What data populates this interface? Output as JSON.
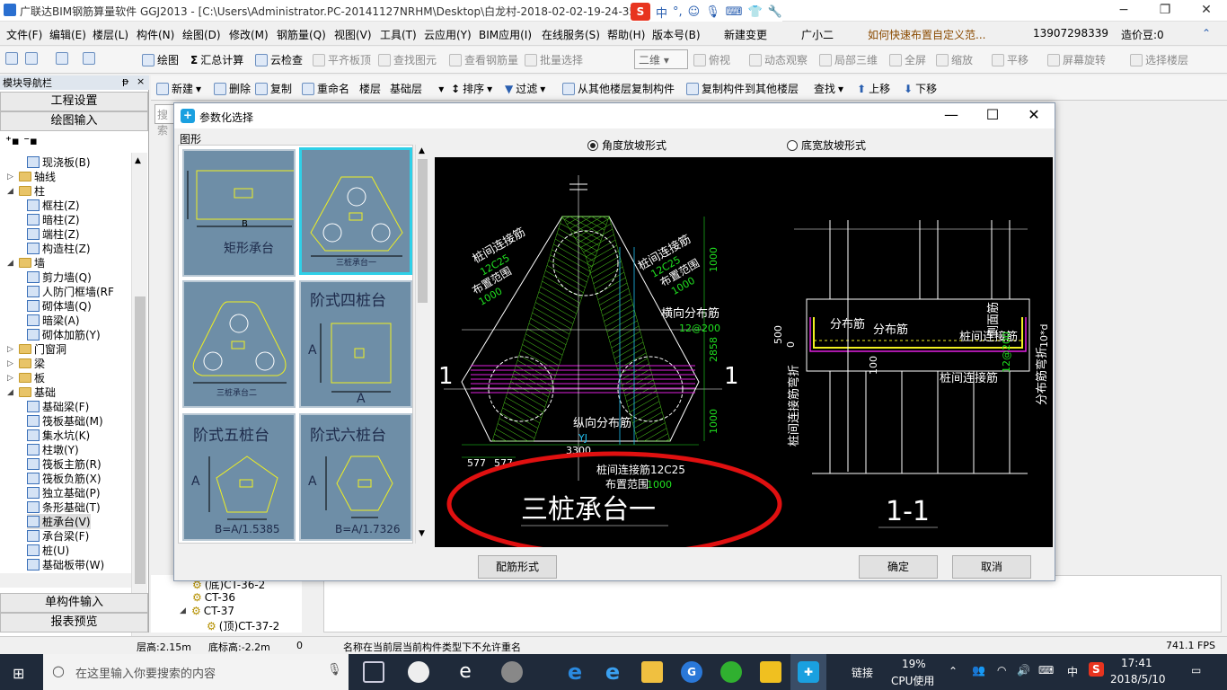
{
  "window": {
    "title": "广联达BIM钢筋算量软件 GGJ2013 - [C:\\Users\\Administrator.PC-20141127NRHM\\Desktop\\白龙村-2018-02-02-19-24-35",
    "ime_logo": "S",
    "ime_lang": "中",
    "ime_punct": "°,",
    "minimize": "−",
    "restore": "❐",
    "close": "✕"
  },
  "menu": [
    "文件(F)",
    "编辑(E)",
    "楼层(L)",
    "构件(N)",
    "绘图(D)",
    "修改(M)",
    "钢筋量(Q)",
    "视图(V)",
    "工具(T)",
    "云应用(Y)",
    "BIM应用(I)",
    "在线服务(S)",
    "帮助(H)",
    "版本号(B)",
    "新建变更",
    "广小二",
    "如何快速布置自定义范...",
    "13907298339",
    "造价豆:0"
  ],
  "toolbar": {
    "items": [
      "绘图",
      "汇总计算",
      "云检查",
      "平齐板顶",
      "查找图元",
      "查看钢筋量",
      "批量选择",
      "俯视",
      "动态观察",
      "局部三维",
      "全屏",
      "缩放",
      "平移",
      "屏幕旋转",
      "选择楼层"
    ],
    "view_combo": "二维"
  },
  "left_panel": {
    "header": "模块导航栏",
    "pin": "ᵽ",
    "close": "×",
    "engineering_settings": "工程设置",
    "drawing_input": "绘图输入",
    "single_input": "单构件输入",
    "report_preview": "报表预览",
    "tree": [
      {
        "label": "现浇板(B)",
        "level": 2,
        "kind": "item"
      },
      {
        "label": "轴线",
        "level": 1,
        "kind": "folder",
        "exp": "▷"
      },
      {
        "label": "柱",
        "level": 1,
        "kind": "folder",
        "exp": "◢"
      },
      {
        "label": "框柱(Z)",
        "level": 2,
        "kind": "item"
      },
      {
        "label": "暗柱(Z)",
        "level": 2,
        "kind": "item"
      },
      {
        "label": "端柱(Z)",
        "level": 2,
        "kind": "item"
      },
      {
        "label": "构造柱(Z)",
        "level": 2,
        "kind": "item"
      },
      {
        "label": "墙",
        "level": 1,
        "kind": "folder",
        "exp": "◢"
      },
      {
        "label": "剪力墙(Q)",
        "level": 2,
        "kind": "item"
      },
      {
        "label": "人防门框墙(RF",
        "level": 2,
        "kind": "item"
      },
      {
        "label": "砌体墙(Q)",
        "level": 2,
        "kind": "item"
      },
      {
        "label": "暗梁(A)",
        "level": 2,
        "kind": "item"
      },
      {
        "label": "砌体加筋(Y)",
        "level": 2,
        "kind": "item"
      },
      {
        "label": "门窗洞",
        "level": 1,
        "kind": "folder",
        "exp": "▷"
      },
      {
        "label": "梁",
        "level": 1,
        "kind": "folder",
        "exp": "▷"
      },
      {
        "label": "板",
        "level": 1,
        "kind": "folder",
        "exp": "▷"
      },
      {
        "label": "基础",
        "level": 1,
        "kind": "folder",
        "exp": "◢"
      },
      {
        "label": "基础梁(F)",
        "level": 2,
        "kind": "item"
      },
      {
        "label": "筏板基础(M)",
        "level": 2,
        "kind": "item"
      },
      {
        "label": "集水坑(K)",
        "level": 2,
        "kind": "item"
      },
      {
        "label": "柱墩(Y)",
        "level": 2,
        "kind": "item"
      },
      {
        "label": "筏板主筋(R)",
        "level": 2,
        "kind": "item"
      },
      {
        "label": "筏板负筋(X)",
        "level": 2,
        "kind": "item"
      },
      {
        "label": "独立基础(P)",
        "level": 2,
        "kind": "item"
      },
      {
        "label": "条形基础(T)",
        "level": 2,
        "kind": "item"
      },
      {
        "label": "桩承台(V)",
        "level": 2,
        "kind": "item",
        "selected": true
      },
      {
        "label": "承台梁(F)",
        "level": 2,
        "kind": "item"
      },
      {
        "label": "桩(U)",
        "level": 2,
        "kind": "item"
      },
      {
        "label": "基础板带(W)",
        "level": 2,
        "kind": "item"
      }
    ]
  },
  "second_toolbar": [
    "新建",
    "删除",
    "复制",
    "重命名",
    "楼层",
    "基础层",
    "排序",
    "过滤",
    "从其他楼层复制构件",
    "复制构件到其他楼层",
    "查找",
    "上移",
    "下移"
  ],
  "search_placeholder": "搜索",
  "mid_tree": [
    {
      "label": "(底)CT-36-2",
      "exp": ""
    },
    {
      "label": "CT-36",
      "exp": ""
    },
    {
      "label": "CT-37",
      "exp": "◢"
    },
    {
      "label": "(顶)CT-37-2",
      "exp": ""
    }
  ],
  "dialog": {
    "title": "参数化选择",
    "shapes_label": "图形",
    "tiles": [
      {
        "label": "矩形承台",
        "selected": false,
        "dim": "B"
      },
      {
        "label": "三桩承台一",
        "selected": true
      },
      {
        "label": "三桩承台二",
        "selected": false
      },
      {
        "label": "阶式四桩台",
        "selected": false,
        "dim": "A"
      },
      {
        "label": "阶式五桩台",
        "selected": false,
        "dim": "A",
        "formula": "B=A/1.5385"
      },
      {
        "label": "阶式六桩台",
        "selected": false,
        "dim": "A",
        "formula": "B=A/1.7326"
      }
    ],
    "radio_angle": "角度放坡形式",
    "radio_width": "底宽放坡形式",
    "rebar_form_button": "配筋形式",
    "ok_button": "确定",
    "cancel_button": "取消",
    "drawing": {
      "title": "三桩承台一",
      "section_title": "1-1",
      "section_mark": "1",
      "labels": {
        "pile_conn_left": "桩间连接筋",
        "rebar_left": "12C25",
        "range_left": "布置范围",
        "range_left_val": "1000",
        "pile_conn_right": "桩间连接筋",
        "rebar_right": "12C25",
        "range_right": "布置范围",
        "range_right_val": "1000",
        "transverse": "横向分布筋",
        "transverse_val": "12@200",
        "longitudinal": "纵向分布筋",
        "yj": "YJ",
        "width": "3300",
        "offset_left": "577",
        "offset_left2": "577",
        "pile_conn_bottom": "桩间连接筋12C25",
        "range_bottom": "布置范围",
        "range_bottom_val": "1000",
        "dim_top": "1000",
        "dim_mid": "2858",
        "dim_bot": "1000",
        "sec_dist1": "分布筋",
        "sec_dist2": "分布筋",
        "sec_pile_conn": "桩间连接筋",
        "sec_pile_conn2": "桩间连接筋",
        "sec_side": "侧面筋",
        "sec_side_val": "12@200",
        "sec_500": "500",
        "sec_0": "0",
        "sec_100": "100",
        "sec_10d": "10*d",
        "sec_left_vert": "桩间连接筋弯折",
        "sec_right_vert": "分布筋弯折"
      }
    }
  },
  "status": {
    "floor_height": "层高:2.15m",
    "bottom_height": "底标高:-2.2m",
    "zero": "0",
    "message": "名称在当前层当前构件类型下不允许重名",
    "fps": "741.1 FPS"
  },
  "taskbar": {
    "search_placeholder": "在这里输入你要搜索的内容",
    "tray_link": "链接",
    "cpu_pct": "19%",
    "cpu_label": "CPU使用",
    "ime": "中",
    "time": "17:41",
    "date": "2018/5/10"
  },
  "colors": {
    "canvas_bg": "#000000",
    "annotation_red": "#e01010",
    "hatch_green": "#55e020",
    "hatch_magenta": "#e020e0",
    "dim_green": "#20e020",
    "tile_bg": "#6e8ea7",
    "tile_selected_border": "#2fd0e8"
  }
}
